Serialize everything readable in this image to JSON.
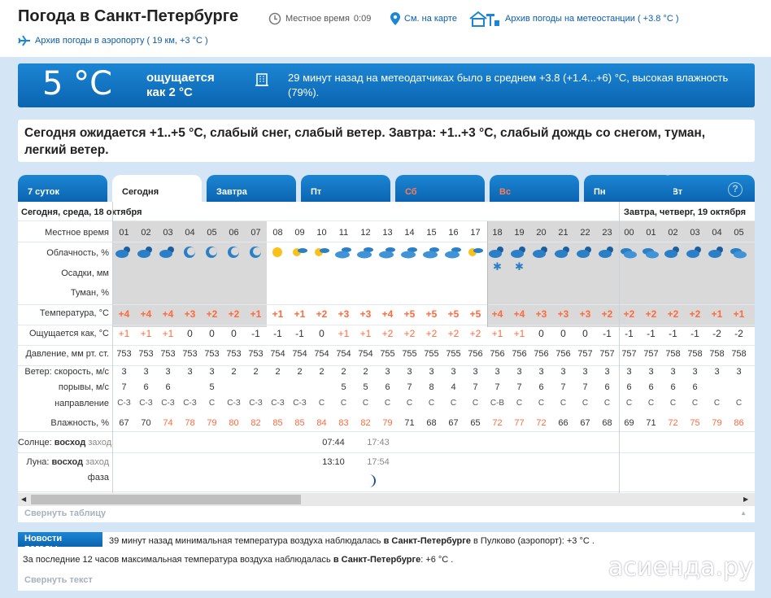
{
  "header": {
    "title": "Погода в Санкт-Петербурге",
    "local_time_label": "Местное время",
    "local_time": "0:09",
    "map_link": "См. на карте",
    "station_link": "Архив погоды на метеостанции ( +3.8 °C )",
    "airport_link": "Архив погоды в аэропорту ( 19 км, +3 °C )"
  },
  "current": {
    "temp": "5 °C",
    "feels_line1": "ощущается",
    "feels_line2": "как 2 °C",
    "info": "29 минут назад на метеодатчиках было в среднем +3.8 (+1.4...+6) °C, высокая влажность (79%)."
  },
  "forecast_text": "Сегодня ожидается +1..+5 °C, слабый снег, слабый ветер. Завтра: +1..+3 °C, слабый дождь со снегом, туман, легкий ветер.",
  "tabs": [
    {
      "label": "7 суток",
      "red": false,
      "active": false
    },
    {
      "label": "Сегодня",
      "red": false,
      "active": true
    },
    {
      "label": "Завтра",
      "red": false,
      "active": false
    },
    {
      "label": "Пт",
      "red": false,
      "active": false
    },
    {
      "label": "Сб",
      "red": true,
      "active": false
    },
    {
      "label": "Вс",
      "red": true,
      "active": false
    },
    {
      "label": "Пн",
      "red": false,
      "active": false
    },
    {
      "label": "Вт",
      "red": false,
      "active": false
    }
  ],
  "help": "?",
  "dates": {
    "today": "Сегодня, среда, 18 октября",
    "tomorrow": "Завтра, четверг, 19 октября"
  },
  "labels": {
    "time": "Местное время",
    "clouds": "Облачность, %",
    "precip": "Осадки, мм",
    "fog": "Туман, %",
    "temp": "Температура, °C",
    "feels": "Ощущается как, °C",
    "pressure": "Давление, мм рт. ст.",
    "wind": "Ветер: скорость, м/с",
    "gusts": "порывы, м/с",
    "dir": "направление",
    "humidity": "Влажность, %",
    "sun_a": "Солнце:",
    "sun_b": "восход",
    "sun_c": "заход",
    "moon_a": "Луна:",
    "moon_b": "восход",
    "moon_c": "заход",
    "phase": "фаза"
  },
  "hours": [
    "01",
    "02",
    "03",
    "04",
    "05",
    "06",
    "07",
    "08",
    "09",
    "10",
    "11",
    "12",
    "13",
    "14",
    "15",
    "16",
    "17",
    "18",
    "19",
    "20",
    "21",
    "22",
    "23",
    "00",
    "01",
    "02",
    "03",
    "04",
    "05"
  ],
  "clouds": [
    "cloud-moon-icon",
    "cloud-moon-icon",
    "cloud-moon-icon",
    "moon-icon",
    "moon-icon",
    "moon-icon",
    "moon-icon",
    "sun-icon",
    "sun-cloud-icon",
    "sun-cloud-icon",
    "cloudy-sun-icon",
    "cloudy-sun-icon",
    "cloudy-sun-icon",
    "cloudy-sun-icon",
    "cloudy-sun-icon",
    "cloudy-sun-icon",
    "sun-cloud-icon",
    "cloud-moon-icon",
    "cloud-moon-icon",
    "cloud-moon-icon",
    "cloud-moon-icon",
    "cloud-moon-icon",
    "cloud-moon-icon",
    "overcast-icon",
    "overcast-icon",
    "cloud-moon-icon",
    "cloud-moon-icon",
    "cloud-moon-icon",
    "overcast-icon"
  ],
  "snow_at": [
    17,
    18
  ],
  "temp": [
    "+4",
    "+4",
    "+4",
    "+3",
    "+2",
    "+2",
    "+1",
    "+1",
    "+1",
    "+2",
    "+3",
    "+3",
    "+4",
    "+5",
    "+5",
    "+5",
    "+5",
    "+4",
    "+4",
    "+3",
    "+3",
    "+3",
    "+2",
    "+2",
    "+2",
    "+2",
    "+2",
    "+1",
    "+1"
  ],
  "feels": [
    "+1",
    "+1",
    "+1",
    "0",
    "0",
    "0",
    "-1",
    "-1",
    "-1",
    "0",
    "+1",
    "+1",
    "+2",
    "+2",
    "+2",
    "+2",
    "+2",
    "+1",
    "+1",
    "0",
    "0",
    "0",
    "-1",
    "-1",
    "-1",
    "-1",
    "-1",
    "-2",
    "-2"
  ],
  "pressure": [
    "753",
    "753",
    "753",
    "753",
    "753",
    "753",
    "753",
    "754",
    "754",
    "754",
    "754",
    "754",
    "755",
    "755",
    "755",
    "755",
    "756",
    "756",
    "756",
    "756",
    "756",
    "757",
    "757",
    "757",
    "757",
    "758",
    "758",
    "758",
    "758"
  ],
  "wind": [
    "3",
    "3",
    "3",
    "3",
    "3",
    "2",
    "2",
    "2",
    "2",
    "2",
    "2",
    "2",
    "3",
    "3",
    "3",
    "3",
    "3",
    "3",
    "3",
    "3",
    "3",
    "3",
    "3",
    "3",
    "3",
    "3",
    "3",
    "3",
    "3"
  ],
  "gusts": [
    "7",
    "6",
    "6",
    "",
    "5",
    "",
    "",
    "",
    "",
    "",
    "5",
    "5",
    "6",
    "7",
    "8",
    "4",
    "7",
    "7",
    "7",
    "6",
    "7",
    "7",
    "6",
    "6",
    "6",
    "6",
    "6",
    "",
    ""
  ],
  "dir": [
    "С-З",
    "С-З",
    "С-З",
    "С-З",
    "С",
    "С-З",
    "С-З",
    "С-З",
    "С-З",
    "С",
    "С",
    "С",
    "С",
    "С",
    "С",
    "С",
    "С",
    "С-В",
    "С",
    "С",
    "С",
    "С",
    "С",
    "С",
    "С",
    "С",
    "С",
    "С",
    "С"
  ],
  "humidity": [
    "67",
    "70",
    "74",
    "78",
    "79",
    "80",
    "82",
    "85",
    "85",
    "84",
    "83",
    "82",
    "79",
    "71",
    "68",
    "67",
    "65",
    "72",
    "77",
    "72",
    "66",
    "67",
    "68",
    "69",
    "71",
    "72",
    "75",
    "79",
    "86"
  ],
  "sun": {
    "rise": "07:44",
    "set": "17:43"
  },
  "moon": {
    "rise": "13:10",
    "set": "17:54"
  },
  "collapse_table": "Свернуть таблицу",
  "news": {
    "tag": "Новости погоды",
    "l1a": "39 минут назад минимальная температура воздуха наблюдалась ",
    "l1b": "в Санкт-Петербурге",
    "l1c": " в Пулково (аэропорт): +3 °C .",
    "l2a": "За последние 12 часов максимальная температура воздуха наблюдалась ",
    "l2b": "в Санкт-Петербурге",
    "l2c": ": +6 °C .",
    "collapse": "Свернуть текст"
  },
  "watermark": "асиенда.ру",
  "colors": {
    "accent": "#0b64b0",
    "warm": "#ff6a3d",
    "night": "#d9d9d9"
  }
}
